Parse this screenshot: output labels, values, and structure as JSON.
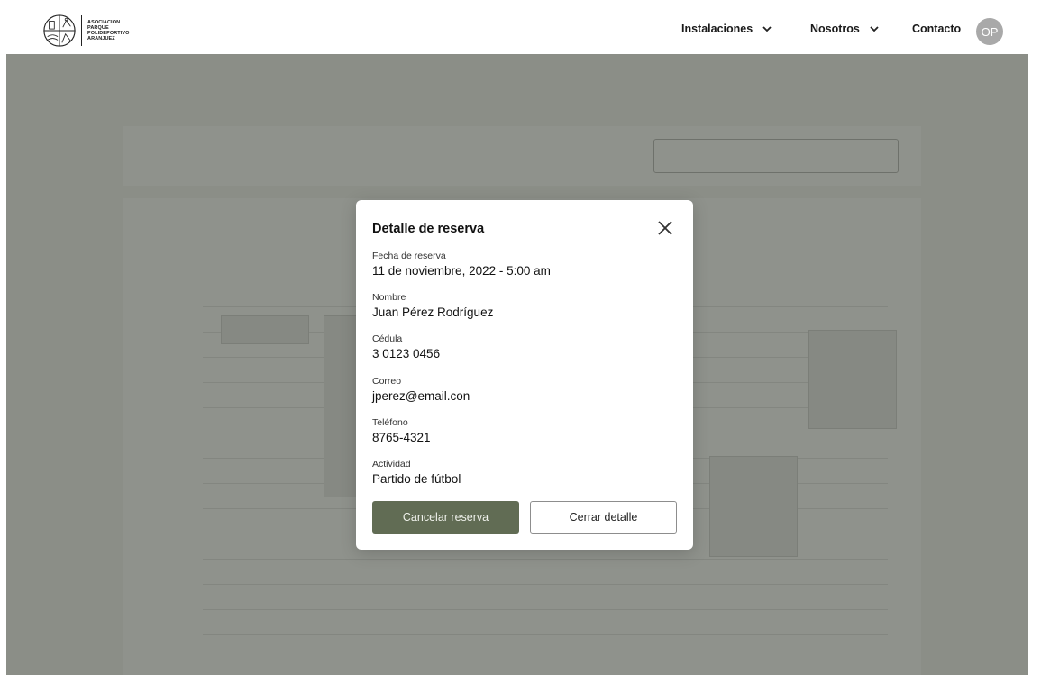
{
  "brand": {
    "logo_lines": [
      "ASOCIACION",
      "PARQUE",
      "POLIDEPORTIVO",
      "ARANJUEZ"
    ]
  },
  "nav": {
    "items": [
      {
        "label": "Instalaciones",
        "has_chevron": true
      },
      {
        "label": "Nosotros",
        "has_chevron": true
      },
      {
        "label": "Contacto",
        "has_chevron": false
      }
    ],
    "avatar_initials": "OP"
  },
  "modal": {
    "title": "Detalle de reserva",
    "fields": [
      {
        "label": "Fecha de reserva",
        "value": "11 de noviembre, 2022 - 5:00 am"
      },
      {
        "label": "Nombre",
        "value": "Juan Pérez Rodríguez"
      },
      {
        "label": "Cédula",
        "value": "3 0123 0456"
      },
      {
        "label": "Correo",
        "value": "jperez@email.con"
      },
      {
        "label": "Teléfono",
        "value": "8765-4321"
      },
      {
        "label": "Actividad",
        "value": "Partido de fútbol"
      }
    ],
    "primary_button": "Cancelar reserva",
    "secondary_button": "Cerrar detalle"
  },
  "colors": {
    "primary_button_bg": "#616c54",
    "overlay": "rgba(40,46,34,0.52)",
    "avatar_bg": "#a9a9a9"
  },
  "icons": {
    "chevron": "chevron-down-icon",
    "close": "close-icon",
    "logo": "logo-emblem-icon"
  }
}
